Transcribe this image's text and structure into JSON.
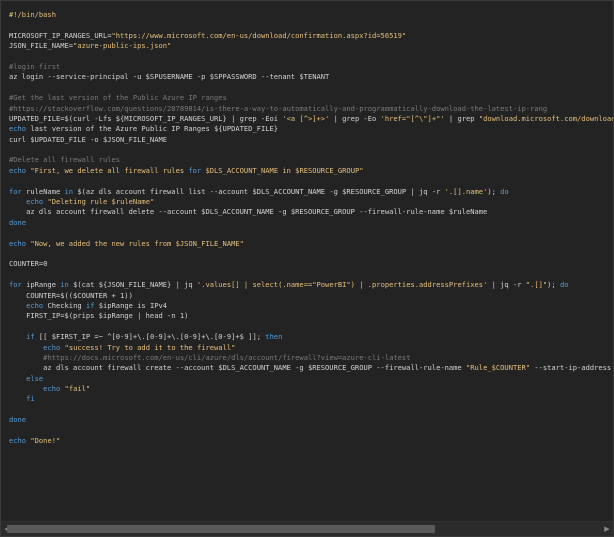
{
  "editor": {
    "lines": [
      [
        [
          "she",
          "#!/bin/bash"
        ]
      ],
      [],
      [
        [
          "txt",
          "MICROSOFT_IP_RANGES_URL="
        ],
        [
          "str",
          "\"https://www.microsoft.com/en-us/download/confirmation.aspx?id=56519\""
        ]
      ],
      [
        [
          "txt",
          "JSON_FILE_NAME="
        ],
        [
          "str",
          "\"azure-public-ips.json\""
        ]
      ],
      [],
      [
        [
          "com",
          "#login first"
        ]
      ],
      [
        [
          "txt",
          "az login --service-principal -u $SPUSERNAME -p $SPPASSWORD --tenant $TENANT"
        ]
      ],
      [],
      [
        [
          "com",
          "#Get the last version of the Public Azure IP ranges"
        ]
      ],
      [
        [
          "com",
          "#https://stackoverflow.com/questions/28789814/is-there-a-way-to-automatically-and-programmatically-download-the-latest-ip-rang"
        ]
      ],
      [
        [
          "txt",
          "UPDATED_FILE=$(curl -Lfs ${MICROSOFT_IP_RANGES_URL} | grep -Eoi "
        ],
        [
          "str",
          "'<a [^>]+>'"
        ],
        [
          "txt",
          " | grep -Eo "
        ],
        [
          "str",
          "'href=\"[^\\\"]+\"'"
        ],
        [
          "txt",
          " | grep "
        ],
        [
          "str",
          "\"download.microsoft.com/download/\""
        ],
        [
          "txt",
          " | grep"
        ]
      ],
      [
        [
          "kw",
          "echo"
        ],
        [
          "txt",
          " last version of the Azure Public IP Ranges ${UPDATED_FILE}"
        ]
      ],
      [
        [
          "txt",
          "curl $UPDATED_FILE -o $JSON_FILE_NAME"
        ]
      ],
      [],
      [
        [
          "com",
          "#Delete all firewall rules"
        ]
      ],
      [
        [
          "kw",
          "echo"
        ],
        [
          "txt",
          " "
        ],
        [
          "str",
          "\"First, we delete all firewall rules "
        ],
        [
          "kw",
          "for"
        ],
        [
          "str",
          " $DLS_ACCOUNT_NAME in $RESOURCE_GROUP\""
        ]
      ],
      [],
      [
        [
          "kw",
          "for"
        ],
        [
          "txt",
          " ruleName "
        ],
        [
          "kw",
          "in"
        ],
        [
          "txt",
          " $(az dls account firewall list --account $DLS_ACCOUNT_NAME -g $RESOURCE_GROUP | jq -r "
        ],
        [
          "str",
          "'.[].name'"
        ],
        [
          "txt",
          "); "
        ],
        [
          "kw",
          "do"
        ]
      ],
      [
        [
          "txt",
          "    "
        ],
        [
          "kw",
          "echo"
        ],
        [
          "txt",
          " "
        ],
        [
          "str",
          "\"Deleting rule $ruleName\""
        ]
      ],
      [
        [
          "txt",
          "    az dls account firewall delete --account $DLS_ACCOUNT_NAME -g $RESOURCE_GROUP --firewall-rule-name $ruleName"
        ]
      ],
      [
        [
          "kw",
          "done"
        ]
      ],
      [],
      [
        [
          "kw",
          "echo"
        ],
        [
          "txt",
          " "
        ],
        [
          "str",
          "\"Now, we added the new rules from $JSON_FILE_NAME\""
        ]
      ],
      [],
      [
        [
          "txt",
          "COUNTER=0"
        ]
      ],
      [],
      [
        [
          "kw",
          "for"
        ],
        [
          "txt",
          " ipRange "
        ],
        [
          "kw",
          "in"
        ],
        [
          "txt",
          " $(cat ${JSON_FILE_NAME} | jq "
        ],
        [
          "str",
          "'.values[] | select(.name==\"PowerBI\") | .properties.addressPrefixes'"
        ],
        [
          "txt",
          " | jq -r "
        ],
        [
          "str",
          "\".[]\""
        ],
        [
          "txt",
          "); "
        ],
        [
          "kw",
          "do"
        ]
      ],
      [
        [
          "txt",
          "    COUNTER=$(($COUNTER + 1))"
        ]
      ],
      [
        [
          "txt",
          "    "
        ],
        [
          "kw",
          "echo"
        ],
        [
          "txt",
          " Checking "
        ],
        [
          "kw",
          "if"
        ],
        [
          "txt",
          " $ipRange is IPv4"
        ]
      ],
      [
        [
          "txt",
          "    FIRST_IP=$(prips $ipRange | head -n 1)"
        ]
      ],
      [],
      [
        [
          "txt",
          "    "
        ],
        [
          "kw",
          "if"
        ],
        [
          "txt",
          " [[ $FIRST_IP =~ ^[0-9]+\\.[0-9]+\\.[0-9]+\\.[0-9]+$ ]]; "
        ],
        [
          "kw",
          "then"
        ]
      ],
      [
        [
          "txt",
          "        "
        ],
        [
          "kw",
          "echo"
        ],
        [
          "txt",
          " "
        ],
        [
          "str",
          "\"success! Try to add it to the firewall\""
        ]
      ],
      [
        [
          "txt",
          "        "
        ],
        [
          "com",
          "#https://docs.microsoft.com/en-us/cli/azure/dls/account/firewall?view=azure-cli-latest"
        ]
      ],
      [
        [
          "txt",
          "        az dls account firewall create --account $DLS_ACCOUNT_NAME -g $RESOURCE_GROUP --firewall-rule-name "
        ],
        [
          "str",
          "\"Rule_$COUNTER\""
        ],
        [
          "txt",
          " --start-ip-address $FIRST_IP"
        ]
      ],
      [
        [
          "txt",
          "    "
        ],
        [
          "kw",
          "else"
        ]
      ],
      [
        [
          "txt",
          "        "
        ],
        [
          "kw",
          "echo"
        ],
        [
          "txt",
          " "
        ],
        [
          "str",
          "\"fail\""
        ]
      ],
      [
        [
          "txt",
          "    "
        ],
        [
          "kw",
          "fi"
        ]
      ],
      [],
      [
        [
          "kw",
          "done"
        ]
      ],
      [],
      [
        [
          "kw",
          "echo"
        ],
        [
          "txt",
          " "
        ],
        [
          "str",
          "\"Done!\""
        ]
      ]
    ]
  },
  "scrollbar": {
    "left_arrow": "◀",
    "right_arrow": "▶"
  }
}
